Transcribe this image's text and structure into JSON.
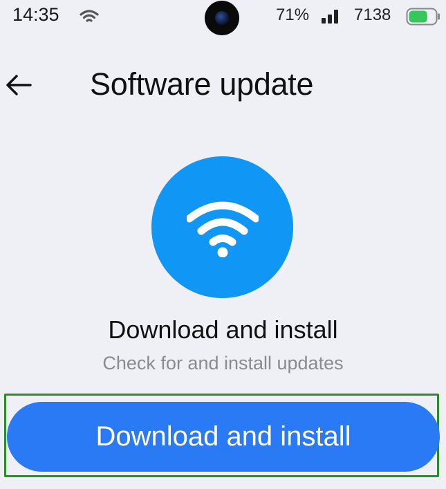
{
  "status_bar": {
    "time": "14:35",
    "battery_percent": "71%",
    "extra_text": "7138",
    "battery_level": 0.71,
    "battery_color": "#34c759"
  },
  "header": {
    "title": "Software update",
    "back_icon": "arrow-left-icon"
  },
  "hero": {
    "icon": "wifi-icon",
    "circle_color": "#1096f5",
    "title": "Download and install",
    "subtitle": "Check for and install updates"
  },
  "action": {
    "button_label": "Download and install",
    "button_color": "#2a7af5",
    "highlight_color": "#2b8a2b"
  }
}
